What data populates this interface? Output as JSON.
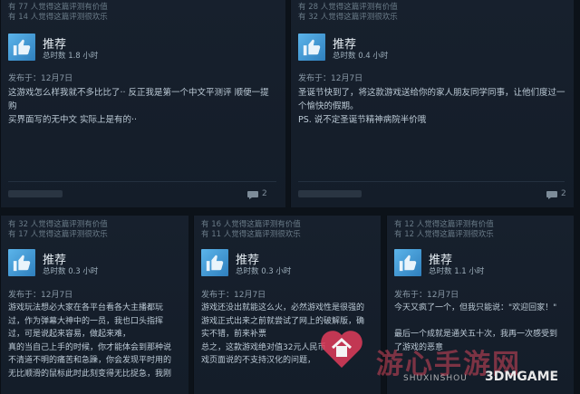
{
  "reviews": [
    {
      "helpful": "有 77 人觉得这篇评测有价值",
      "funny": "有 14 人觉得这篇评测很欢乐",
      "verdict": "推荐",
      "hours": "总时数 1.8 小时",
      "posted": "发布于：12月7日",
      "text": "这游戏怎么样我就不多比比了·· 反正我是第一个中文平测评 顺便一提 购\n买界面写的无中文 实际上是有的··",
      "comments": "2"
    },
    {
      "helpful": "有 28 人觉得这篇评测有价值",
      "funny": "有 32 人觉得这篇评测很欢乐",
      "verdict": "推荐",
      "hours": "总时数 0.4 小时",
      "posted": "发布于：12月7日",
      "text": "圣诞节快到了，将这款游戏送给你的家人朋友同学同事，让他们度过一\n个愉快的假期。\nPS. 说不定圣诞节精神病院半价哦",
      "comments": "2"
    },
    {
      "helpful": "有 32 人觉得这篇评测有价值",
      "funny": "有 17 人觉得这篇评测很欢乐",
      "verdict": "推荐",
      "hours": "总时数 0.3 小时",
      "posted": "发布于：12月7日",
      "text": "游戏玩法想必大家在各平台看各大主播都玩\n过，作为弹幕大神中的一员，我也口头指挥\n过，可是说起来容易，做起来难，\n真的当自己上手的时候，你才能体会到那种说\n不清道不明的痛苦和急躁，你会发现平时用的\n无比顺滑的鼠标此时此刻变得无比捉急，我刚"
    },
    {
      "helpful": "有 16 人觉得这篇评测有价值",
      "funny": "有 11 人觉得这篇评测很欢乐",
      "verdict": "推荐",
      "hours": "总时数 0.3 小时",
      "posted": "发布于：12月7日",
      "text": "游戏还没出就能这么火，必然游戏性是很强的\n游戏正式出来之前就尝试了网上的破解版，确\n实不错，前来补票\n总之，这款游戏绝对值32元人民币\n戏页面说的不支持汉化的问题，"
    },
    {
      "helpful": "有 12 人觉得这篇评测有价值",
      "funny": "有 12 人觉得这篇评测很欢乐",
      "verdict": "推荐",
      "hours": "总时数 1.1 小时",
      "posted": "发布于：12月7日",
      "text": "今天又疯了一个，但我只能说：\"欢迎回家！\"\n\n最后一个成就是通关五十次，我再一次感受到\n了游戏的恶意"
    }
  ],
  "watermark": {
    "cn": "游心手游网",
    "en": "SHUXINSHOU",
    "site": "3DMGAME"
  }
}
